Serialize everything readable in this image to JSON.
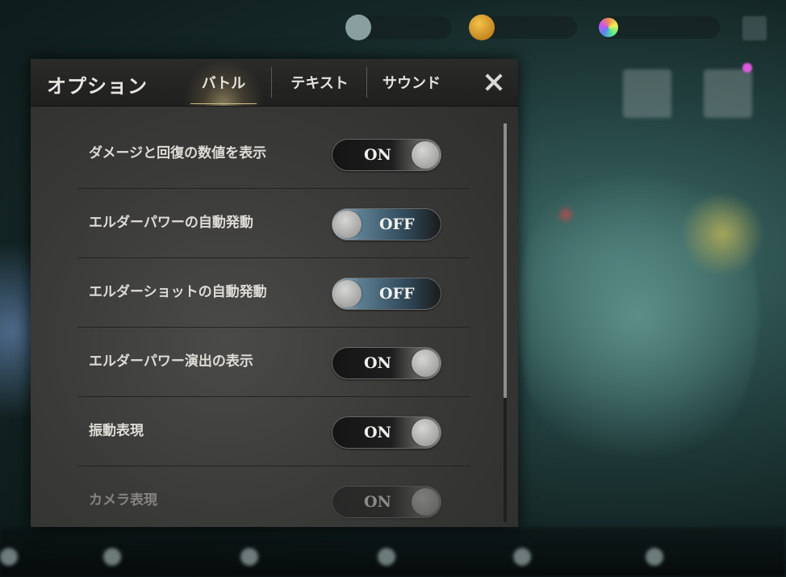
{
  "dialog": {
    "title": "オプション",
    "tabs": [
      {
        "label": "バトル",
        "active": true
      },
      {
        "label": "テキスト",
        "active": false
      },
      {
        "label": "サウンド",
        "active": false
      }
    ]
  },
  "settings": [
    {
      "label": "ダメージと回復の数値を表示",
      "state": "ON"
    },
    {
      "label": "エルダーパワーの自動発動",
      "state": "OFF"
    },
    {
      "label": "エルダーショットの自動発動",
      "state": "OFF"
    },
    {
      "label": "エルダーパワー演出の表示",
      "state": "ON"
    },
    {
      "label": "振動表現",
      "state": "ON"
    },
    {
      "label": "カメラ表現",
      "state": "ON"
    }
  ],
  "colors": {
    "accent": "#c9b98a",
    "panel": "#3a3a38",
    "toggle_off_blue": "#5d7f93"
  }
}
